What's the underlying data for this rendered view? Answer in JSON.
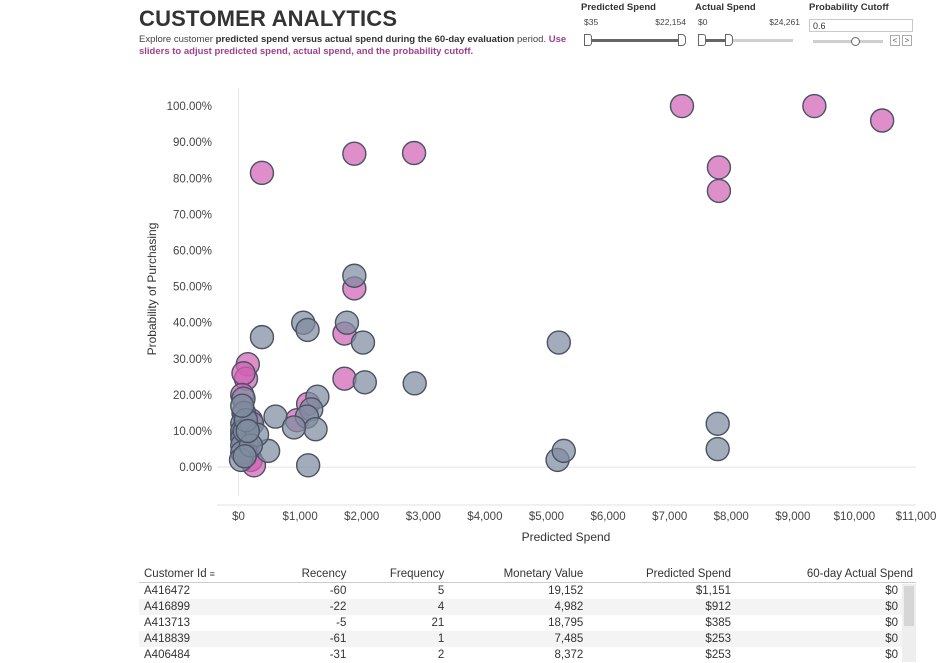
{
  "header": {
    "title": "CUSTOMER ANALYTICS",
    "subtitle_plain_1": "Explore customer ",
    "subtitle_bold": "predicted spend versus actual spend during the 60-day evaluation",
    "subtitle_plain_2": " period. ",
    "subtitle_hint": "Use sliders to adjust predicted spend, actual spend, and the probability cutoff."
  },
  "filters": {
    "predicted_spend": {
      "label": "Predicted Spend",
      "min_label": "$35",
      "max_label": "$22,154"
    },
    "actual_spend": {
      "label": "Actual Spend",
      "min_label": "$0",
      "max_label": "$24,261"
    },
    "probability_cutoff": {
      "label": "Probability Cutoff",
      "value": "0.6",
      "slider_position": 0.6
    }
  },
  "colors": {
    "above_cutoff": "#d162b3",
    "below_cutoff": "#7f8c9f",
    "hint": "#a0418f"
  },
  "chart_data": {
    "type": "scatter",
    "xlabel": "Predicted Spend",
    "ylabel": "Probability of Purchasing",
    "xlim": [
      -350,
      11000
    ],
    "ylim": [
      -0.08,
      1.05
    ],
    "x_ticks": [
      "$0",
      "$1,000",
      "$2,000",
      "$3,000",
      "$4,000",
      "$5,000",
      "$6,000",
      "$7,000",
      "$8,000",
      "$9,000",
      "$10,000",
      "$11,000"
    ],
    "x_tick_values": [
      0,
      1000,
      2000,
      3000,
      4000,
      5000,
      6000,
      7000,
      8000,
      9000,
      10000,
      11000
    ],
    "y_ticks": [
      "0.00%",
      "10.00%",
      "20.00%",
      "30.00%",
      "40.00%",
      "50.00%",
      "60.00%",
      "70.00%",
      "80.00%",
      "90.00%",
      "100.00%"
    ],
    "y_tick_values": [
      0,
      0.1,
      0.2,
      0.3,
      0.4,
      0.5,
      0.6,
      0.7,
      0.8,
      0.9,
      1.0
    ],
    "grid": false,
    "series": [
      {
        "group": "above_cutoff",
        "points": [
          [
            7200,
            1.0
          ],
          [
            9350,
            1.0
          ],
          [
            10450,
            0.96
          ],
          [
            7800,
            0.83
          ],
          [
            7800,
            0.765
          ],
          [
            380,
            0.815
          ],
          [
            1880,
            0.868
          ],
          [
            2850,
            0.87
          ],
          [
            1880,
            0.495
          ],
          [
            1720,
            0.37
          ],
          [
            1720,
            0.245
          ],
          [
            150,
            0.285
          ],
          [
            120,
            0.245
          ],
          [
            80,
            0.26
          ],
          [
            60,
            0.2
          ],
          [
            1130,
            0.175
          ],
          [
            950,
            0.13
          ],
          [
            200,
            0.13
          ],
          [
            100,
            0.12
          ],
          [
            60,
            0.09
          ],
          [
            150,
            0.06
          ],
          [
            200,
            0.02
          ],
          [
            250,
            0.005
          ],
          [
            120,
            0.04
          ],
          [
            80,
            0.15
          ]
        ]
      },
      {
        "group": "below_cutoff",
        "points": [
          [
            1880,
            0.53
          ],
          [
            1760,
            0.4
          ],
          [
            1050,
            0.4
          ],
          [
            1120,
            0.38
          ],
          [
            2020,
            0.345
          ],
          [
            5200,
            0.345
          ],
          [
            380,
            0.36
          ],
          [
            2050,
            0.235
          ],
          [
            2860,
            0.232
          ],
          [
            1280,
            0.195
          ],
          [
            1180,
            0.16
          ],
          [
            1110,
            0.14
          ],
          [
            600,
            0.14
          ],
          [
            1250,
            0.105
          ],
          [
            900,
            0.11
          ],
          [
            480,
            0.045
          ],
          [
            1130,
            0.005
          ],
          [
            5180,
            0.02
          ],
          [
            5280,
            0.045
          ],
          [
            7780,
            0.12
          ],
          [
            7780,
            0.05
          ],
          [
            80,
            0.19
          ],
          [
            90,
            0.15
          ],
          [
            60,
            0.12
          ],
          [
            60,
            0.1
          ],
          [
            60,
            0.08
          ],
          [
            60,
            0.06
          ],
          [
            60,
            0.04
          ],
          [
            40,
            0.02
          ],
          [
            100,
            0.1
          ],
          [
            220,
            0.12
          ],
          [
            300,
            0.09
          ],
          [
            200,
            0.06
          ],
          [
            120,
            0.13
          ],
          [
            60,
            0.17
          ],
          [
            100,
            0.03
          ],
          [
            150,
            0.1
          ]
        ]
      }
    ]
  },
  "table": {
    "columns": [
      "Customer Id",
      "Recency",
      "Frequency",
      "Monetary Value",
      "Predicted Spend",
      "60-day Actual Spend"
    ],
    "rows": [
      [
        "A416472",
        "-60",
        "5",
        "19,152",
        "$1,151",
        "$0"
      ],
      [
        "A416899",
        "-22",
        "4",
        "4,982",
        "$912",
        "$0"
      ],
      [
        "A413713",
        "-5",
        "21",
        "18,795",
        "$385",
        "$0"
      ],
      [
        "A418839",
        "-61",
        "1",
        "7,485",
        "$253",
        "$0"
      ],
      [
        "A406484",
        "-31",
        "2",
        "8,372",
        "$253",
        "$0"
      ]
    ]
  }
}
